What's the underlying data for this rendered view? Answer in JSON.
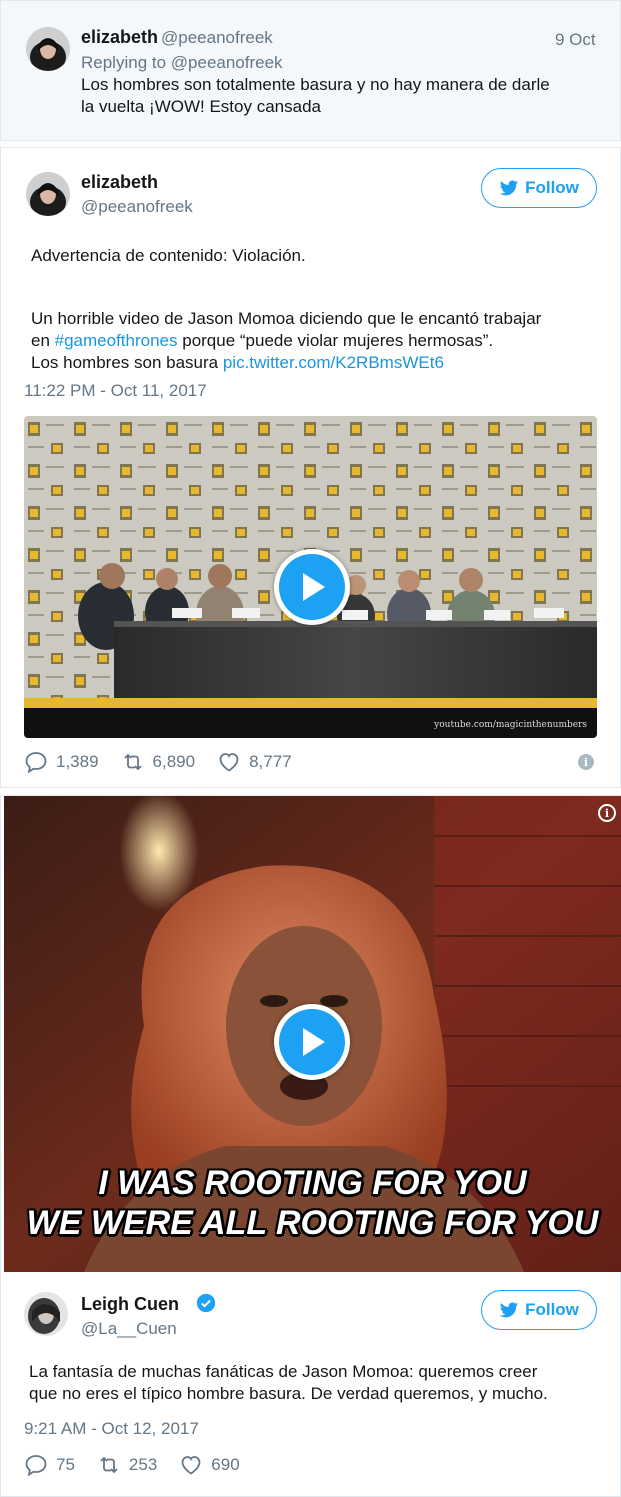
{
  "reply_tweet": {
    "name": "elizabeth",
    "handle": "@peeanofreek",
    "date": "9 Oct",
    "replying_to": "Replying to @peeanofreek",
    "text_line1": "Los hombres son totalmente basura y no hay manera de darle",
    "text_line2": "la vuelta ¡WOW! Estoy cansada"
  },
  "main_tweet": {
    "name": "elizabeth",
    "handle": "@peeanofreek",
    "follow_label": "Follow",
    "warning": "Advertencia de contenido: Violación.",
    "line1": "Un horrible video de Jason Momoa diciendo que le encantó trabajar",
    "line2_prefix": "en ",
    "hashtag": "#gameofthrones",
    "line2_suffix": " porque “puede violar mujeres hermosas”.",
    "line3_prefix": "Los hombres son basura ",
    "pic_link": "pic.twitter.com/K2RBmsWEt6",
    "timestamp": "11:22 PM - Oct 11, 2017",
    "video_watermark": "youtube.com/magicinthenumbers",
    "replies": "1,389",
    "retweets": "6,890",
    "likes": "8,777"
  },
  "gif_tweet": {
    "caption_line1": "I WAS ROOTING FOR YOU",
    "caption_line2": "WE WERE ALL ROOTING FOR YOU",
    "name": "Leigh Cuen",
    "handle": "@La__Cuen",
    "follow_label": "Follow",
    "text_line1": "La fantasía de muchas fanáticas de Jason Momoa: queremos creer",
    "text_line2": "que no eres el típico hombre basura. De verdad queremos, y mucho.",
    "timestamp": "9:21 AM - Oct 12, 2017",
    "replies": "75",
    "retweets": "253",
    "likes": "690"
  },
  "colors": {
    "accent": "#1da1f2",
    "link": "#1b95e0",
    "muted": "#657786",
    "text": "#14171a",
    "reply_bg": "#f5f8fa"
  },
  "icons": [
    "reply-icon",
    "retweet-icon",
    "like-icon",
    "info-icon",
    "twitter-bird-icon",
    "play-icon",
    "verified-badge-icon"
  ]
}
